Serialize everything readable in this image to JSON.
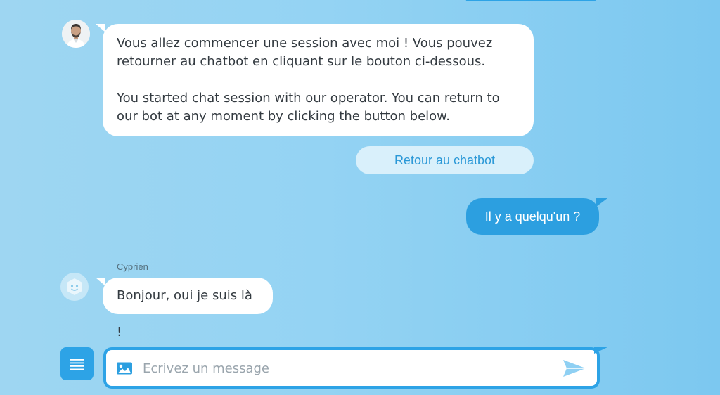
{
  "conversation": {
    "operator_message": {
      "avatar": "operator-avatar-photo",
      "paragraph_fr": "Vous allez commencer une session avec moi ! Vous pouvez retourner au chatbot en cliquant sur le bouton ci-dessous.",
      "paragraph_en": "You started chat session with our operator. You can return to our bot at any moment by clicking the button below."
    },
    "return_button_label": "Retour au chatbot",
    "user_message": "Il y a quelqu'un ?",
    "reply": {
      "sender": "Cyprien",
      "avatar": "bot-face-icon",
      "text": "Bonjour, oui je suis là !"
    }
  },
  "composer": {
    "placeholder": "Ecrivez un message",
    "value": "",
    "icons": {
      "menu": "menu-icon",
      "attach": "image-attach-icon",
      "send": "send-icon"
    }
  },
  "colors": {
    "background_light": "#9ed6f2",
    "background_dark": "#7cc8f0",
    "accent": "#2da3e6",
    "user_bubble": "#2c9fe0",
    "incoming_bubble": "#ffffff",
    "quick_reply_bg": "#d9f0fb",
    "text_dark": "#333a40"
  }
}
